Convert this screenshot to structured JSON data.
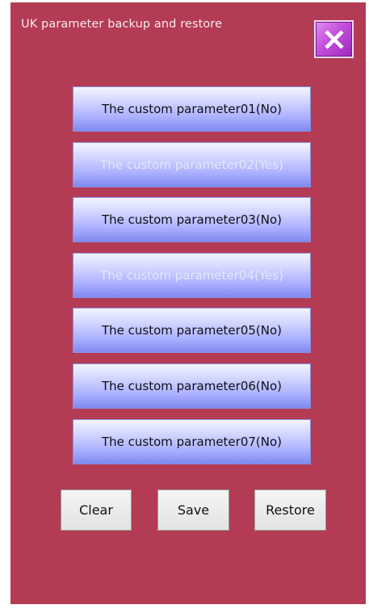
{
  "window": {
    "title": "UK parameter backup and restore"
  },
  "close_button": {
    "icon": "close-icon"
  },
  "parameters": [
    {
      "label": "The custom parameter01(No)",
      "saved": false
    },
    {
      "label": "The custom parameter02(Yes)",
      "saved": true
    },
    {
      "label": "The custom parameter03(No)",
      "saved": false
    },
    {
      "label": "The custom parameter04(Yes)",
      "saved": true
    },
    {
      "label": "The custom parameter05(No)",
      "saved": false
    },
    {
      "label": "The custom parameter06(No)",
      "saved": false
    },
    {
      "label": "The custom parameter07(No)",
      "saved": false
    }
  ],
  "actions": {
    "clear_label": "Clear",
    "save_label": "Save",
    "restore_label": "Restore"
  },
  "colors": {
    "background": "#b33b53",
    "param_button": "#a9afff",
    "close_button": "#c34fdc",
    "action_button": "#e3e3e3"
  }
}
